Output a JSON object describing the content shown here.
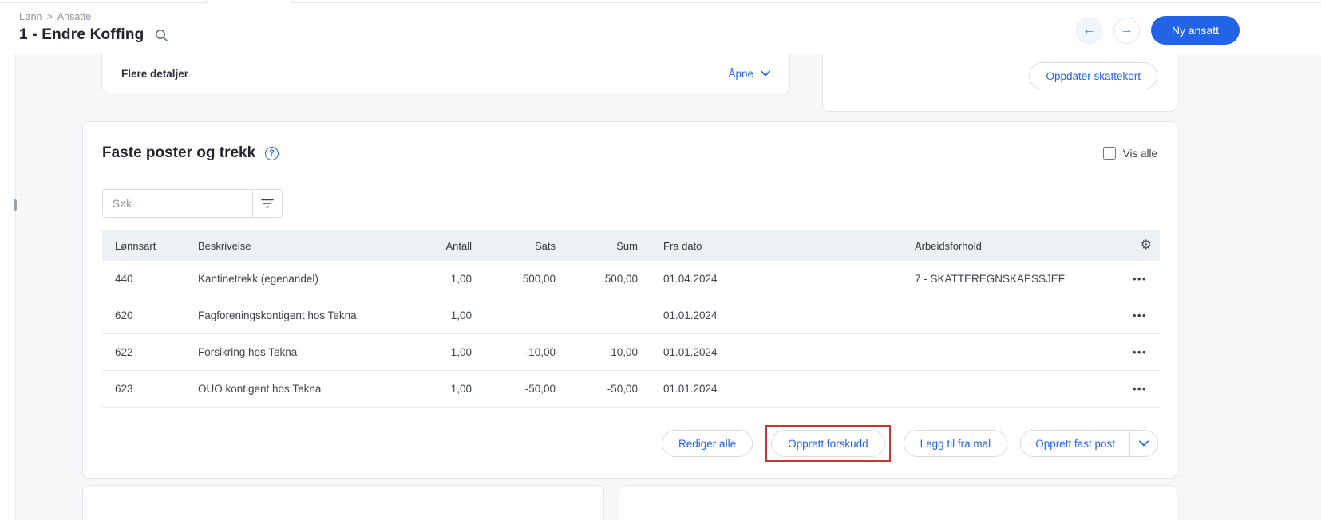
{
  "header": {
    "breadcrumb": {
      "part1": "Lønn",
      "separator": ">",
      "part2": "Ansatte"
    },
    "title": "1 - Endre Koffing",
    "new_employee_button": "Ny ansatt"
  },
  "details_card": {
    "label": "Flere detaljer",
    "open_link": "Åpne"
  },
  "tax_card": {
    "update_button": "Oppdater skattekort"
  },
  "fixed_posts": {
    "title": "Faste poster og trekk",
    "show_all_label": "Vis alle",
    "search_placeholder": "Søk",
    "table": {
      "columns": [
        "Lønnsart",
        "Beskrivelse",
        "Antall",
        "Sats",
        "Sum",
        "Fra dato",
        "Arbeidsforhold"
      ],
      "rows": [
        {
          "lonnsart": "440",
          "beskrivelse": "Kantinetrekk (egenandel)",
          "antall": "1,00",
          "sats": "500,00",
          "sum": "500,00",
          "fra_dato": "01.04.2024",
          "arbeidsforhold": "7 - SKATTEREGNSKAPSSJEF"
        },
        {
          "lonnsart": "620",
          "beskrivelse": "Fagforeningskontigent hos Tekna",
          "antall": "1,00",
          "sats": "",
          "sum": "",
          "fra_dato": "01.01.2024",
          "arbeidsforhold": ""
        },
        {
          "lonnsart": "622",
          "beskrivelse": "Forsikring hos Tekna",
          "antall": "1,00",
          "sats": "-10,00",
          "sum": "-10,00",
          "fra_dato": "01.01.2024",
          "arbeidsforhold": ""
        },
        {
          "lonnsart": "623",
          "beskrivelse": "OUO kontigent hos Tekna",
          "antall": "1,00",
          "sats": "-50,00",
          "sum": "-50,00",
          "fra_dato": "01.01.2024",
          "arbeidsforhold": ""
        }
      ]
    },
    "actions": {
      "edit_all": "Rediger alle",
      "create_advance": "Opprett forskudd",
      "add_from_template": "Legg til fra mal",
      "create_fixed_post": "Opprett fast post"
    }
  },
  "icons": {
    "back_arrow": "←",
    "forward_arrow": "→",
    "help": "?",
    "gear": "⚙",
    "more_horizontal": "•••"
  },
  "colors": {
    "accent_blue": "#2264e5",
    "annotation_red": "#c9362f",
    "table_header_bg": "#edf0f5",
    "page_bg": "#f6f7f9"
  }
}
